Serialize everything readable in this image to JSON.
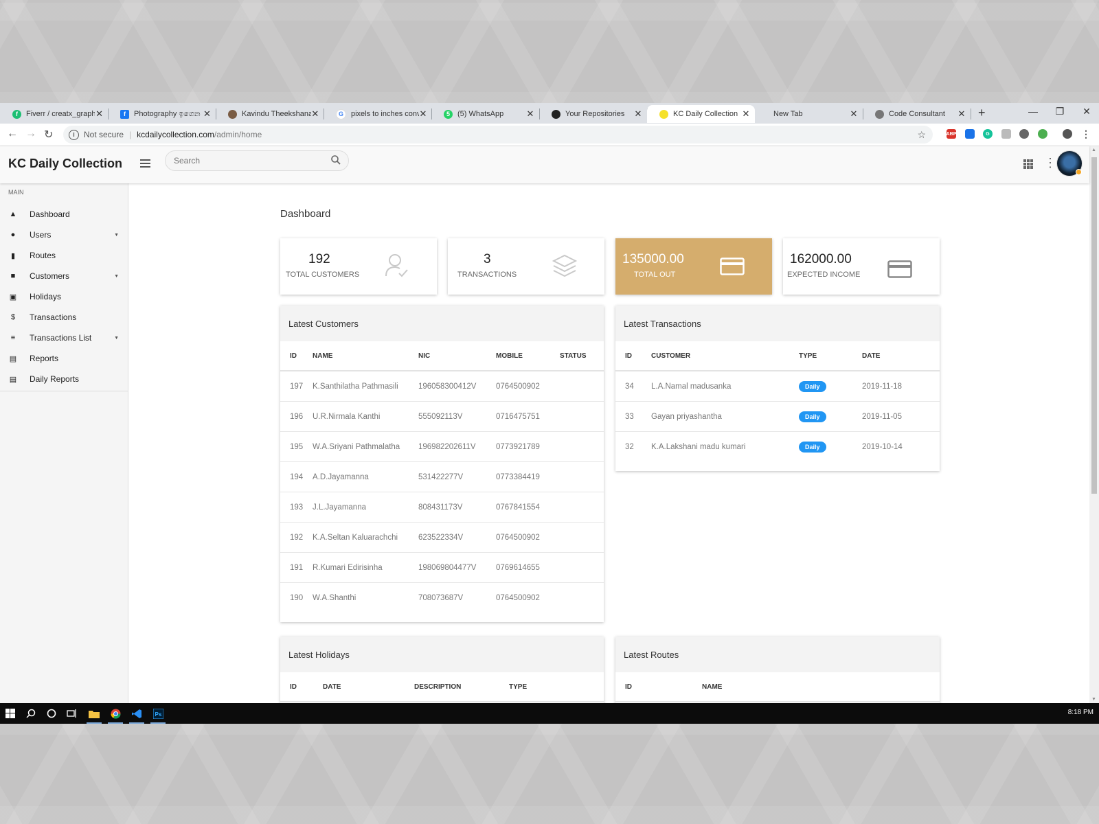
{
  "browser": {
    "tabs": [
      {
        "title": "Fiverr / creatx_graphic",
        "icon": "fiverr-icon",
        "color": "#1dbf73"
      },
      {
        "title": "Photography ඉගෙන ග",
        "icon": "facebook-icon",
        "color": "#1877f2"
      },
      {
        "title": "Kavindu Theekshana H",
        "icon": "user-photo-icon",
        "color": "#7a5c44"
      },
      {
        "title": "pixels to inches convert",
        "icon": "google-icon",
        "color": "#4285f4"
      },
      {
        "title": "(5) WhatsApp",
        "icon": "whatsapp-icon",
        "color": "#25d366"
      },
      {
        "title": "Your Repositories",
        "icon": "github-icon",
        "color": "#222222"
      },
      {
        "title": "KC Daily Collection",
        "icon": "yellow-dot-icon",
        "color": "#f5e12a"
      },
      {
        "title": "New Tab",
        "icon": "",
        "color": ""
      },
      {
        "title": "Code Consultant",
        "icon": "globe-icon",
        "color": "#777777"
      }
    ],
    "security": "Not secure",
    "url_domain": "kcdailycollection.com",
    "url_path": "/admin/home"
  },
  "app": {
    "brand": "KC Daily Collection",
    "search_placeholder": "Search"
  },
  "sidebar": {
    "section": "MAIN",
    "items": [
      {
        "label": "Dashboard",
        "icon": "dashboard-icon",
        "caret": false
      },
      {
        "label": "Users",
        "icon": "user-icon",
        "caret": true
      },
      {
        "label": "Routes",
        "icon": "map-icon",
        "caret": false
      },
      {
        "label": "Customers",
        "icon": "contact-icon",
        "caret": true
      },
      {
        "label": "Holidays",
        "icon": "calendar-icon",
        "caret": false
      },
      {
        "label": "Transactions",
        "icon": "dollar-icon",
        "caret": false
      },
      {
        "label": "Transactions List",
        "icon": "list-icon",
        "caret": true
      },
      {
        "label": "Reports",
        "icon": "document-icon",
        "caret": false
      },
      {
        "label": "Daily Reports",
        "icon": "document-icon",
        "caret": false
      }
    ]
  },
  "dashboard": {
    "title": "Dashboard",
    "cards": [
      {
        "value": "192",
        "label": "TOTAL CUSTOMERS",
        "icon": "user-check-icon"
      },
      {
        "value": "3",
        "label": "TRANSACTIONS",
        "icon": "layers-icon"
      },
      {
        "value": "135000.00",
        "label": "TOTAL OUT",
        "icon": "credit-card-icon"
      },
      {
        "value": "162000.00",
        "label": "EXPECTED INCOME",
        "icon": "credit-card-icon"
      }
    ],
    "highlight_color": "#d5ad6d"
  },
  "latest_customers": {
    "title": "Latest Customers",
    "headers": [
      "ID",
      "NAME",
      "NIC",
      "MOBILE",
      "STATUS"
    ],
    "rows": [
      [
        "197",
        "K.Santhilatha Pathmasili",
        "196058300412V",
        "0764500902",
        ""
      ],
      [
        "196",
        "U.R.Nirmala Kanthi",
        "555092113V",
        "0716475751",
        ""
      ],
      [
        "195",
        "W.A.Sriyani Pathmalatha",
        "196982202611V",
        "0773921789",
        ""
      ],
      [
        "194",
        "A.D.Jayamanna",
        "531422277V",
        "0773384419",
        ""
      ],
      [
        "193",
        "J.L.Jayamanna",
        "808431173V",
        "0767841554",
        ""
      ],
      [
        "192",
        "K.A.Seltan Kaluarachchi",
        "623522334V",
        "0764500902",
        ""
      ],
      [
        "191",
        "R.Kumari Edirisinha",
        "198069804477V",
        "0769614655",
        ""
      ],
      [
        "190",
        "W.A.Shanthi",
        "708073687V",
        "0764500902",
        ""
      ]
    ]
  },
  "latest_transactions": {
    "title": "Latest Transactions",
    "headers": [
      "ID",
      "CUSTOMER",
      "TYPE",
      "DATE"
    ],
    "rows": [
      [
        "34",
        "L.A.Namal madusanka",
        "Daily",
        "2019-11-18"
      ],
      [
        "33",
        "Gayan priyashantha",
        "Daily",
        "2019-11-05"
      ],
      [
        "32",
        "K.A.Lakshani madu kumari",
        "Daily",
        "2019-10-14"
      ]
    ],
    "pill_color": "#2196f3"
  },
  "latest_holidays": {
    "title": "Latest Holidays",
    "headers": [
      "ID",
      "DATE",
      "DESCRIPTION",
      "TYPE"
    ]
  },
  "latest_routes": {
    "title": "Latest Routes",
    "headers": [
      "ID",
      "NAME"
    ]
  },
  "taskbar": {
    "clock": "8:18 PM"
  }
}
